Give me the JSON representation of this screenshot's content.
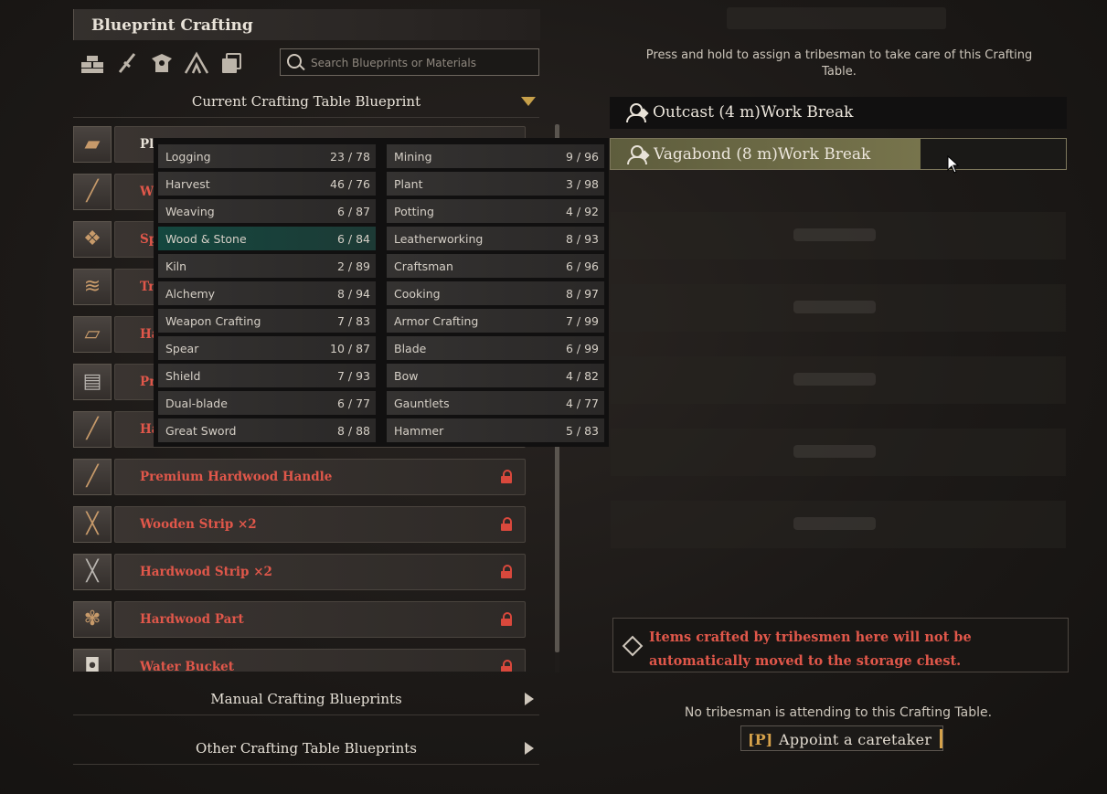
{
  "panel_title": "Blueprint Crafting",
  "category_icons": [
    "materials-icon",
    "weapons-icon",
    "armor-icon",
    "tent-icon",
    "cards-icon"
  ],
  "search": {
    "placeholder": "Search Blueprints or Materials"
  },
  "sections": {
    "current": "Current Crafting Table Blueprint",
    "manual": "Manual Crafting Blueprints",
    "other": "Other Crafting Table Blueprints"
  },
  "blueprints": [
    {
      "name": "Pl",
      "locked": false,
      "icon": "plank-icon"
    },
    {
      "name": "W",
      "locked": true,
      "icon": "stick-icon"
    },
    {
      "name": "Sp",
      "locked": true,
      "icon": "scroll-icon"
    },
    {
      "name": "Tr",
      "locked": true,
      "icon": "bundle-icon"
    },
    {
      "name": "Ha",
      "locked": true,
      "icon": "board-icon"
    },
    {
      "name": "Pr",
      "locked": true,
      "icon": "panel-icon"
    },
    {
      "name": "Ha",
      "locked": true,
      "icon": "handle-icon"
    },
    {
      "name": "Premium Hardwood Handle",
      "locked": true,
      "icon": "premium-handle-icon"
    },
    {
      "name": "Wooden Strip ×2",
      "locked": true,
      "icon": "strip-icon"
    },
    {
      "name": "Hardwood Strip ×2",
      "locked": true,
      "icon": "hardwood-strip-icon"
    },
    {
      "name": "Hardwood Part",
      "locked": true,
      "icon": "wood-part-icon"
    },
    {
      "name": "Water Bucket",
      "locked": true,
      "icon": "bucket-icon"
    }
  ],
  "proficiencies": {
    "left": [
      {
        "name": "Logging",
        "value": "23 / 78"
      },
      {
        "name": "Harvest",
        "value": "46 / 76"
      },
      {
        "name": "Weaving",
        "value": "6 / 87"
      },
      {
        "name": "Wood & Stone",
        "value": "6 / 84",
        "highlight": true
      },
      {
        "name": "Kiln",
        "value": "2 / 89"
      },
      {
        "name": "Alchemy",
        "value": "8 / 94"
      },
      {
        "name": "Weapon Crafting",
        "value": "7 / 83"
      },
      {
        "name": "Spear",
        "value": "10 / 87"
      },
      {
        "name": "Shield",
        "value": "7 / 93"
      },
      {
        "name": "Dual-blade",
        "value": "6 / 77"
      },
      {
        "name": "Great Sword",
        "value": "8 / 88"
      }
    ],
    "right": [
      {
        "name": "Mining",
        "value": "9 / 96"
      },
      {
        "name": "Plant",
        "value": "3 / 98"
      },
      {
        "name": "Potting",
        "value": "4 / 92"
      },
      {
        "name": "Leatherworking",
        "value": "8 / 93"
      },
      {
        "name": "Craftsman",
        "value": "6 / 96"
      },
      {
        "name": "Cooking",
        "value": "8 / 97"
      },
      {
        "name": "Armor Crafting",
        "value": "7 / 99"
      },
      {
        "name": "Blade",
        "value": "6 / 99"
      },
      {
        "name": "Bow",
        "value": "4 / 82"
      },
      {
        "name": "Gauntlets",
        "value": "4 / 77"
      },
      {
        "name": "Hammer",
        "value": "5 / 83"
      }
    ]
  },
  "hint": "Press and hold to assign a tribesman to take care of this Crafting Table.",
  "workers": [
    {
      "name": "Outcast (4 m)Work Break"
    },
    {
      "name": "Vagabond (8 m)Work Break",
      "hold_progress": 0.68
    }
  ],
  "notice": "Items crafted by tribesmen here will not be automatically moved to the storage chest.",
  "status": "No tribesman is attending to this Crafting Table.",
  "appoint": {
    "key": "[P]",
    "label": "Appoint a caretaker"
  },
  "colors": {
    "locked_text": "#e0574a",
    "accent": "#d6a24a",
    "highlight": "#14473f"
  }
}
